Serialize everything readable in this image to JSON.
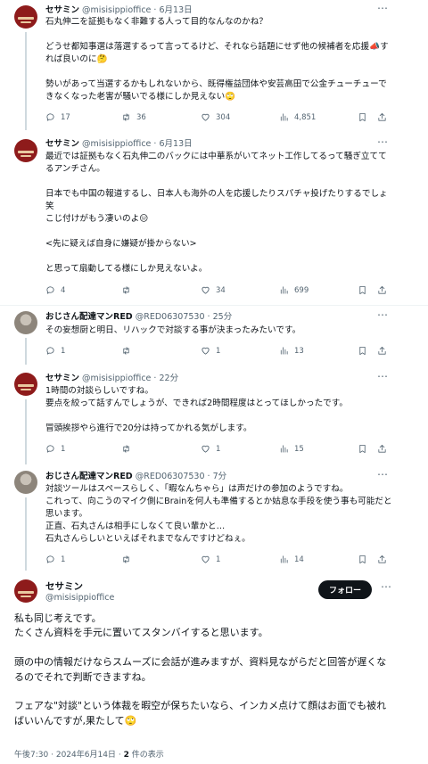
{
  "icons": {
    "more": "more-horizontal-icon",
    "reply": "reply-bubble-icon",
    "retweet": "retweet-arrows-icon",
    "like": "heart-icon",
    "views": "bar-chart-views-icon",
    "bookmark": "bookmark-icon",
    "share": "share-upload-icon"
  },
  "tweets": [
    {
      "name": "セサミン",
      "handle": "@misisippioffice",
      "sep": "·",
      "time": "6月13日",
      "text": "石丸伸二を証拠もなく非難する人って目的なんなのかね？\n\nどうせ都知事選は落選するって言ってるけど、それなら話題にせず他の候補者を応援📣すれば良いのに🤔\n\n勢いがあって当選するかもしれないから、既得権益団体や安芸高田で公金チューチューできなくなった老害が騒いでる様にしか見えない🙄",
      "replies": "17",
      "retweets": "36",
      "likes": "304",
      "views": "4,851"
    },
    {
      "name": "セサミン",
      "handle": "@misisippioffice",
      "sep": "·",
      "time": "6月13日",
      "text": "最近では証拠もなく石丸伸二のバックには中華系がいてネット工作してるって騒ぎ立ててるアンチさん。\n\n日本でも中国の報道するし、日本人も海外の人を応援したりスパチャ投げたりするでしょ笑\nこじ付けがもう凄いのよ😑\n\n<先に疑えば自身に嫌疑が掛からない>\n\nと思って扇動してる様にしか見えないよ。",
      "replies": "4",
      "retweets": "",
      "likes": "34",
      "views": "699"
    },
    {
      "name": "おじさん配達マンRED",
      "handle": "@RED06307530",
      "sep": "·",
      "time": "25分",
      "text": "その妄想厨と明日、リハックで対談する事が決まったみたいです。",
      "replies": "1",
      "retweets": "",
      "likes": "1",
      "views": "13"
    },
    {
      "name": "セサミン",
      "handle": "@misisippioffice",
      "sep": "·",
      "time": "22分",
      "text": "1時間の対談らしいですね。\n要点を絞って話すんでしょうが、できれば2時間程度はとってほしかったです。\n\n冒頭挨拶やら進行で20分は持ってかれる気がします。",
      "replies": "1",
      "retweets": "",
      "likes": "1",
      "views": "15"
    },
    {
      "name": "おじさん配達マンRED",
      "handle": "@RED06307530",
      "sep": "·",
      "time": "7分",
      "text": "対談ツールはスペースらしく、「暇なんちゃら」は声だけの参加のようですね。\nこれって、向こうのマイク側にBrainを何人も準備するとか姑息な手段を使う事も可能だと思います。\n正直、石丸さんは相手にしなくて良い輩かと…\n石丸さんらしいといえばそれまでなんですけどねぇ。",
      "replies": "1",
      "retweets": "",
      "likes": "1",
      "views": "14"
    }
  ],
  "main_tweet": {
    "name": "セサミン",
    "handle": "@misisippioffice",
    "follow_label": "フォロー",
    "text": "私も同じ考えです。\nたくさん資料を手元に置いてスタンバイすると思います。\n\n頭の中の情報だけならスムーズに会話が進みますが、資料見ながらだと回答が遅くなるのでそれで判断できますね。\n\nフェアな\"対談\"という体裁を暇空が保ちたいなら、インカメ点けて顔はお面でも被ればいいんですが,果たして🙄",
    "time": "午後7:30",
    "date_sep": "·",
    "date": "2024年6月14日",
    "meta_sep": "·",
    "views_count": "2",
    "views_label": "件の表示"
  }
}
